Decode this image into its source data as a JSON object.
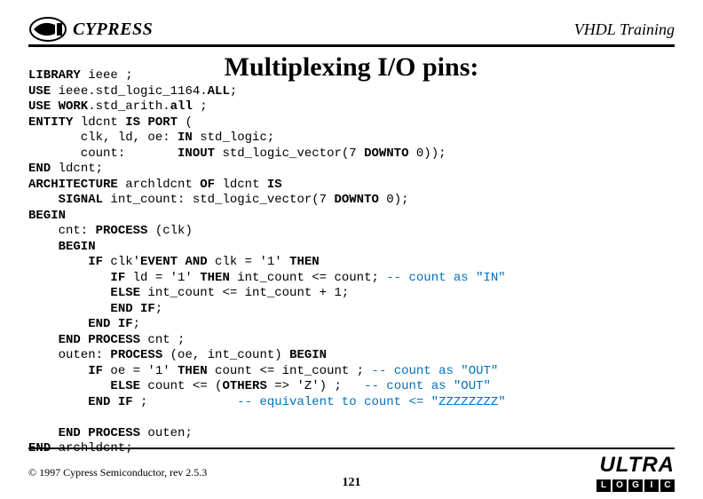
{
  "header": {
    "brand_text": "CYPRESS",
    "right_text": "VHDL Training"
  },
  "title": "Multiplexing I/O pins:",
  "code": {
    "l1a": "LIBRARY",
    "l1b": " ieee ;",
    "l2a": "USE",
    "l2b": " ieee.std_logic_1164.",
    "l2c": "ALL",
    "l2d": ";",
    "l3a": "USE WORK",
    "l3b": ".std_arith.",
    "l3c": "all",
    "l3d": " ;",
    "l4a": "ENTITY",
    "l4b": " ldcnt ",
    "l4c": "IS PORT",
    "l4d": " (",
    "l5": "       clk, ld, oe: ",
    "l5b": "IN",
    "l5c": " std_logic;",
    "l6": "       count:       ",
    "l6b": "INOUT",
    "l6c": " std_logic_vector(7 ",
    "l6d": "DOWNTO",
    "l6e": " 0));",
    "l7a": "END",
    "l7b": " ldcnt;",
    "l8a": "ARCHITECTURE",
    "l8b": " archldcnt ",
    "l8c": "OF",
    "l8d": " ldcnt ",
    "l8e": "IS",
    "l9a": "    SIGNAL",
    "l9b": " int_count: std_logic_vector(7 ",
    "l9c": "DOWNTO",
    "l9d": " 0);",
    "l10": "BEGIN",
    "l11a": "    cnt: ",
    "l11b": "PROCESS",
    "l11c": " (clk)",
    "l12": "    BEGIN",
    "l13a": "        IF",
    "l13b": " clk'",
    "l13c": "EVENT AND",
    "l13d": " clk = '1' ",
    "l13e": "THEN",
    "l14a": "           IF",
    "l14b": " ld = '1' ",
    "l14c": "THEN",
    "l14d": " int_count <= count; ",
    "l14e": "-- count as \"IN\"",
    "l15a": "           ELSE",
    "l15b": " int_count <= int_count + 1;",
    "l16a": "           END IF",
    "l16b": ";",
    "l17a": "        END IF",
    "l17b": ";",
    "l18a": "    END PROCESS",
    "l18b": " cnt ;",
    "l19a": "    outen: ",
    "l19b": "PROCESS",
    "l19c": " (oe, int_count) ",
    "l19d": "BEGIN",
    "l20a": "        IF",
    "l20b": " oe = '1' ",
    "l20c": "THEN",
    "l20d": " count <= int_count ; ",
    "l20e": "-- count as \"OUT\"",
    "l21a": "           ELSE",
    "l21b": " count <= (",
    "l21c": "OTHERS",
    "l21d": " => 'Z') ;   ",
    "l21e": "-- count as \"OUT\"",
    "l22a": "        END IF",
    "l22b": " ;            ",
    "l22e": "-- equivalent to count <= \"ZZZZZZZZ\"",
    "l23": "",
    "l24a": "    END PROCESS",
    "l24b": " outen;",
    "l25a": "END",
    "l25b": " archldcnt;"
  },
  "footer": {
    "copyright": "© 1997 Cypress Semiconductor, rev 2.5.3",
    "page_number": "121",
    "ultra_word": "ULTRA",
    "ultra_letters": [
      "L",
      "O",
      "G",
      "I",
      "C"
    ]
  }
}
